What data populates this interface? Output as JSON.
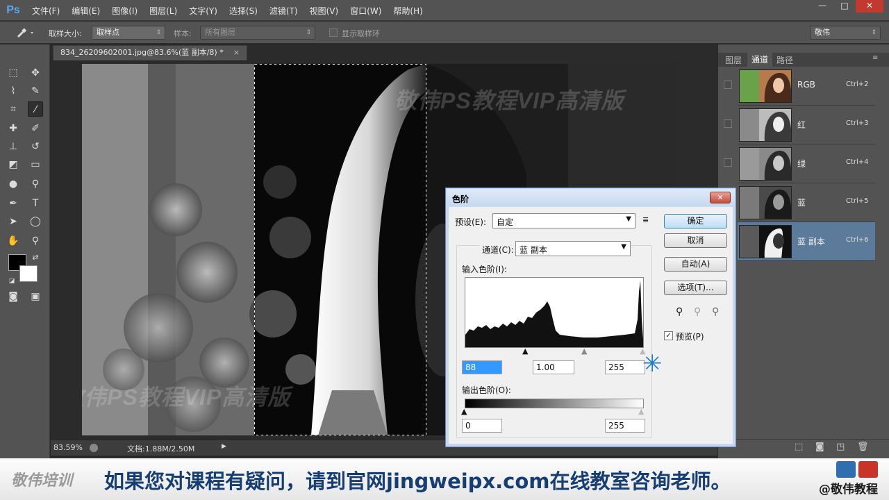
{
  "app": {
    "logo": "Ps",
    "menus": [
      "文件(F)",
      "编辑(E)",
      "图像(I)",
      "图层(L)",
      "文字(Y)",
      "选择(S)",
      "滤镜(T)",
      "视图(V)",
      "窗口(W)",
      "帮助(H)"
    ],
    "window_controls": [
      "—",
      "□",
      "✕"
    ]
  },
  "options_bar": {
    "sample_size_label": "取样大小:",
    "sample_size_value": "取样点",
    "sample_label": "样本:",
    "sample_value": "所有图层",
    "show_ring_label": "显示取样环",
    "workspace": "敬伟"
  },
  "document": {
    "tab_title": "834_26209602001.jpg@83.6%(蓝 副本/8) *",
    "tab_close": "×",
    "watermark_top": "敬伟PS教程VIP高清版",
    "watermark_bottom": "敬伟PS教程VIP高清版",
    "zoom": "83.59%",
    "doc_size": "文档:1.88M/2.50M",
    "status_arrow": "▶"
  },
  "channels_panel": {
    "tabs": [
      "图层",
      "通道",
      "路径"
    ],
    "active_tab": "通道",
    "channels": [
      {
        "name": "RGB",
        "shortcut": "Ctrl+2",
        "selected": false
      },
      {
        "name": "红",
        "shortcut": "Ctrl+3",
        "selected": false
      },
      {
        "name": "绿",
        "shortcut": "Ctrl+4",
        "selected": false
      },
      {
        "name": "蓝",
        "shortcut": "Ctrl+5",
        "selected": false
      },
      {
        "name": "蓝 副本",
        "shortcut": "Ctrl+6",
        "selected": true
      }
    ]
  },
  "levels_dialog": {
    "title": "色阶",
    "close": "✕",
    "preset_label": "预设(E):",
    "preset_value": "自定",
    "channel_label": "通道(C):",
    "channel_value": "蓝 副本",
    "input_levels_label": "输入色阶(I):",
    "input_black": "88",
    "input_gamma": "1.00",
    "input_white": "255",
    "output_levels_label": "输出色阶(O):",
    "output_black": "0",
    "output_white": "255",
    "buttons": {
      "ok": "确定",
      "cancel": "取消",
      "auto": "自动(A)",
      "options": "选项(T)..."
    },
    "preview_label": "预览(P)",
    "preview_checked": true
  },
  "banner": {
    "logo": "敬伟培训",
    "message": "如果您对课程有疑问，请到官网jingweipx.com在线教室咨询老师。",
    "weibo": "@敬伟教程"
  }
}
